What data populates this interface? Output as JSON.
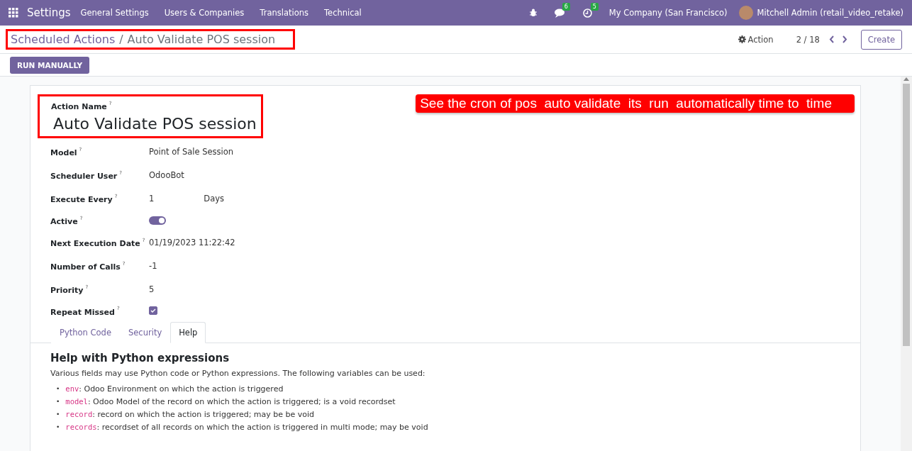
{
  "navbar": {
    "app": "Settings",
    "menus": [
      "General Settings",
      "Users & Companies",
      "Translations",
      "Technical"
    ],
    "messages_count": "6",
    "activities_count": "5",
    "company": "My Company (San Francisco)",
    "user": "Mitchell Admin (retail_video_retake)"
  },
  "control_panel": {
    "breadcrumb": "Scheduled Actions",
    "separator": "/",
    "title": "Auto Validate POS session",
    "action": "Action",
    "pager": "2 / 18",
    "create": "Create"
  },
  "run_button": "RUN MANUALLY",
  "form": {
    "name_label": "Action Name",
    "name_help": "?",
    "name": "Auto Validate POS session",
    "fields": [
      {
        "kind": "text",
        "label": "Model",
        "help": "?",
        "value": "Point of Sale Session"
      },
      {
        "kind": "text",
        "label": "Scheduler User",
        "help": "?",
        "value": "OdooBot"
      },
      {
        "kind": "interval",
        "label": "Execute Every",
        "help": "?",
        "value": "1",
        "unit": "Days"
      },
      {
        "kind": "toggle",
        "label": "Active",
        "help": "?",
        "on": true
      },
      {
        "kind": "text",
        "label": "Next Execution Date",
        "help": "?",
        "value": "01/19/2023 11:22:42"
      },
      {
        "kind": "text",
        "label": "Number of Calls",
        "help": "?",
        "value": "-1"
      },
      {
        "kind": "text",
        "label": "Priority",
        "help": "?",
        "value": "5"
      },
      {
        "kind": "checkbox",
        "label": "Repeat Missed",
        "help": "?",
        "checked": true
      }
    ]
  },
  "annotation": "See the cron of pos  auto validate  its  run  automatically time to  time",
  "tabs": [
    {
      "label": "Python Code",
      "selected": false
    },
    {
      "label": "Security",
      "selected": false
    },
    {
      "label": "Help",
      "selected": true
    }
  ],
  "help": {
    "heading": "Help with Python expressions",
    "intro": "Various fields may use Python code or Python expressions. The following variables can be used:",
    "items": [
      {
        "marker": "•",
        "code": "env",
        "text": ": Odoo Environment on which the action is triggered"
      },
      {
        "marker": "•",
        "code": "model",
        "text": ": Odoo Model of the record on which the action is triggered; is a void recordset"
      },
      {
        "marker": "•",
        "code": "record",
        "text": ": record on which the action is triggered; may be be void"
      },
      {
        "marker": "•",
        "code": "records",
        "text": ": recordset of all records on which the action is triggered in multi mode; may be void"
      }
    ]
  }
}
